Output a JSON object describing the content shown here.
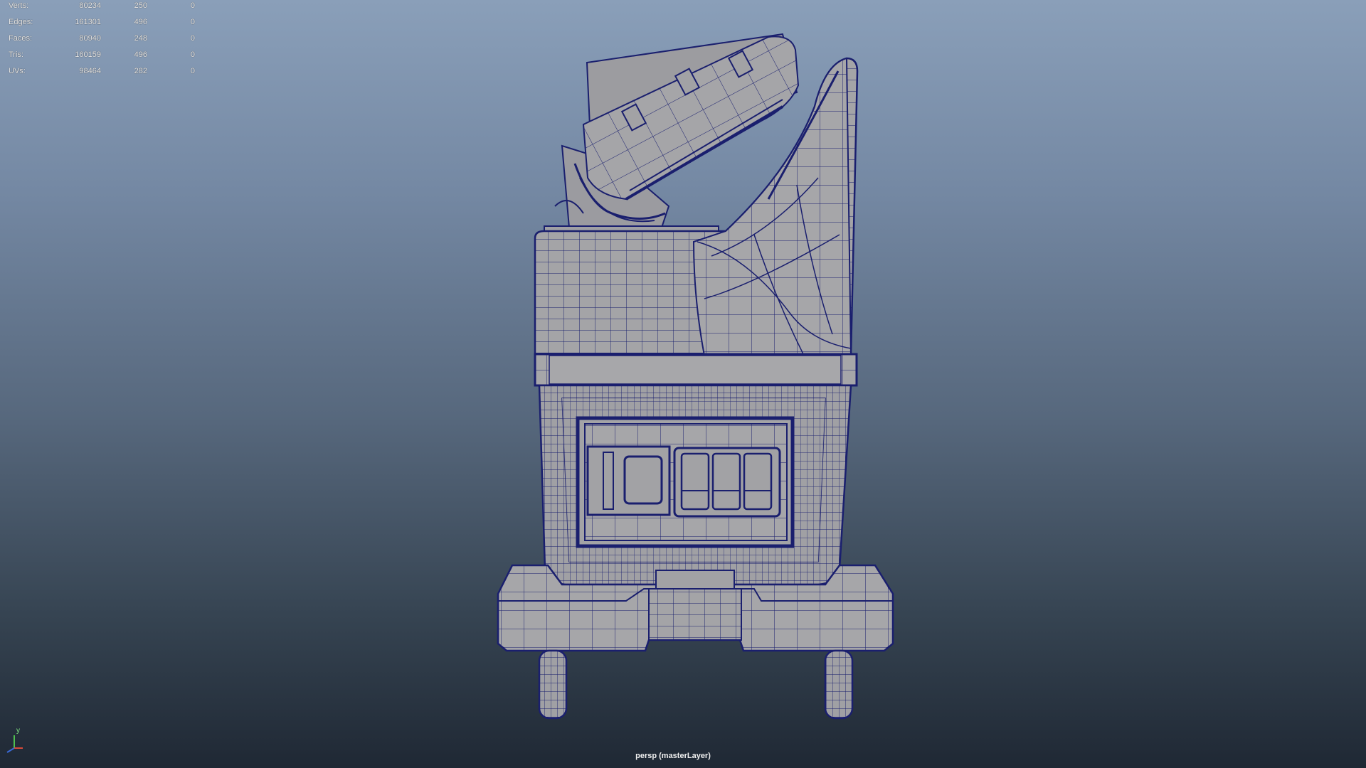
{
  "hud": {
    "rows": [
      {
        "label": "Verts:",
        "scene": "80234",
        "selected": "250",
        "extra": "0"
      },
      {
        "label": "Edges:",
        "scene": "161301",
        "selected": "496",
        "extra": "0"
      },
      {
        "label": "Faces:",
        "scene": "80940",
        "selected": "248",
        "extra": "0"
      },
      {
        "label": "Tris:",
        "scene": "160159",
        "selected": "496",
        "extra": "0"
      },
      {
        "label": "UVs:",
        "scene": "98464",
        "selected": "282",
        "extra": "0"
      }
    ]
  },
  "viewport": {
    "camera_label": "persp (masterLayer)",
    "axis_label": "y",
    "background_top": "#8a9fb9",
    "background_bottom": "#1f2834",
    "wire_color": "#1a1f6e",
    "mesh_color": "#a3a3a6",
    "display_mode": "shaded-with-wireframe"
  },
  "icons": {
    "axis": "axis-gizmo-icon"
  }
}
